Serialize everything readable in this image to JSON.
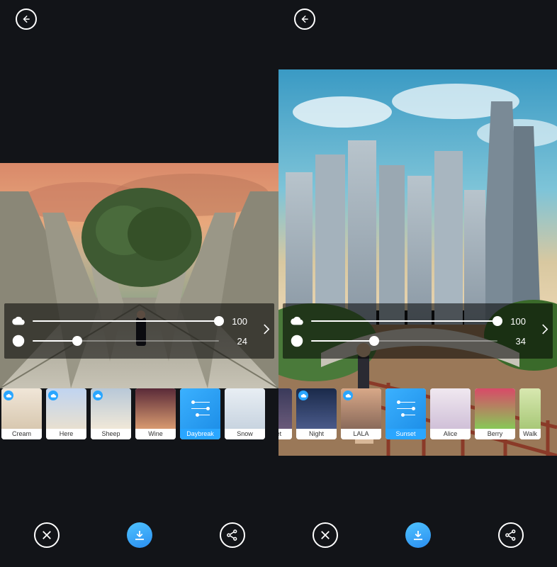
{
  "left": {
    "sliders": {
      "cloud": 100,
      "aperture": 24
    },
    "filters": [
      {
        "name": "Cream",
        "badge": true,
        "class": "g-cream"
      },
      {
        "name": "Here",
        "badge": true,
        "class": "g-here"
      },
      {
        "name": "Sheep",
        "badge": true,
        "class": "g-sheep"
      },
      {
        "name": "Wine",
        "badge": false,
        "class": "g-wine"
      },
      {
        "name": "Daybreak",
        "badge": false,
        "selected": true
      },
      {
        "name": "Snow",
        "badge": false,
        "class": "g-snow"
      }
    ]
  },
  "right": {
    "sliders": {
      "cloud": 100,
      "aperture": 34
    },
    "filters": [
      {
        "name": "ve Viet",
        "badge": false,
        "class": "g-veviet",
        "partial": "left"
      },
      {
        "name": "Night",
        "badge": true,
        "class": "g-night"
      },
      {
        "name": "LALA",
        "badge": true,
        "class": "g-lala"
      },
      {
        "name": "Sunset",
        "badge": false,
        "selected": true
      },
      {
        "name": "Alice",
        "badge": false,
        "class": "g-alice"
      },
      {
        "name": "Berry",
        "badge": false,
        "class": "g-berry"
      },
      {
        "name": "Walk",
        "badge": false,
        "class": "g-walk",
        "partial": "right"
      }
    ]
  }
}
